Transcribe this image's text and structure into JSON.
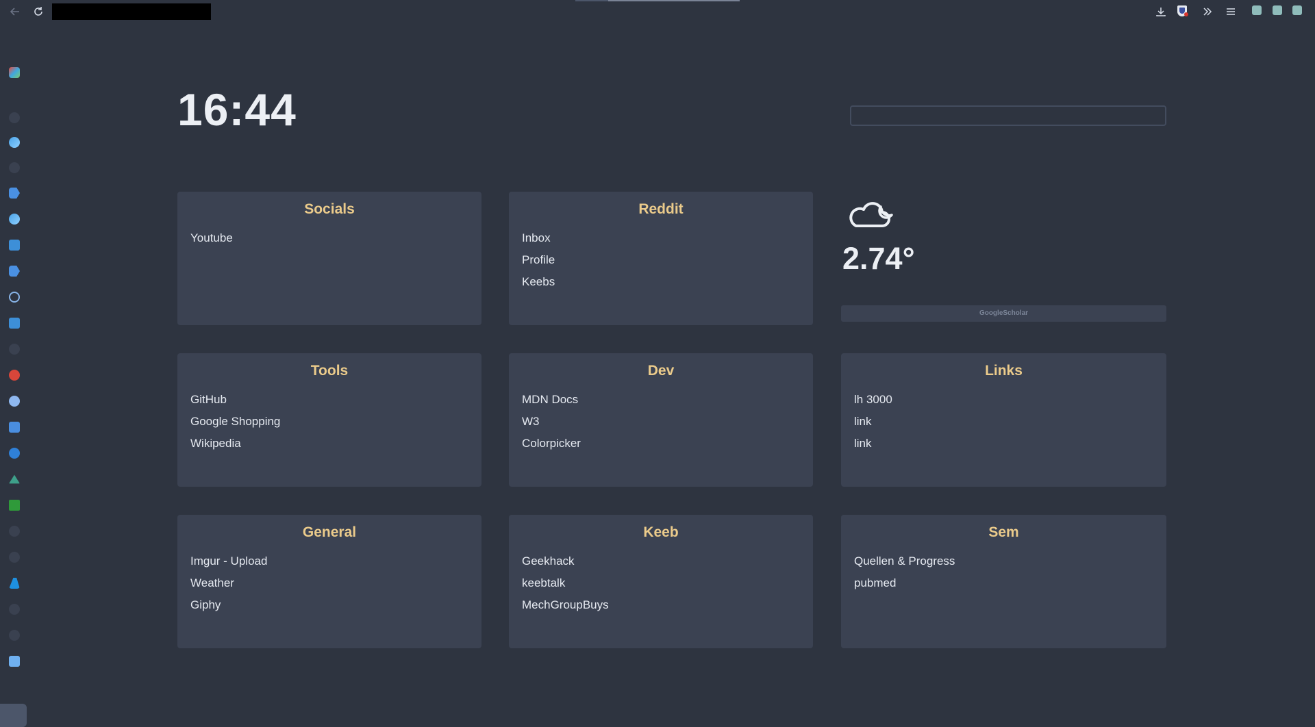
{
  "browser": {
    "back_icon": "arrow-left-icon",
    "reload_icon": "reload-icon",
    "toolbar_icons": [
      "download-icon",
      "shield-extension-icon",
      "overflow-chevrons-icon",
      "menu-icon"
    ]
  },
  "sidebar": {
    "icons": [
      "colorful-app-icon",
      "faded-icon",
      "blue-swirl-icon",
      "faded-icon",
      "blue-tag-icon",
      "blue-swirl-icon",
      "blue-window-icon",
      "blue-tag-icon",
      "info-icon",
      "blue-window-icon",
      "github-icon",
      "red-circle-icon",
      "chart-icon",
      "mt-icon",
      "blue-circle-icon",
      "green-triangle-icon",
      "green-square-icon",
      "github-icon",
      "github-icon",
      "blue-person-icon",
      "github-icon",
      "github-icon",
      "atom-icon"
    ]
  },
  "clock": {
    "time": "16:44"
  },
  "search": {
    "placeholder": "",
    "value": ""
  },
  "weather": {
    "icon": "cloud-moon-icon",
    "temperature": "2.74°"
  },
  "scholar": {
    "label": "GoogleScholar"
  },
  "cards": [
    {
      "title": "Socials",
      "links": [
        "Youtube"
      ]
    },
    {
      "title": "Reddit",
      "links": [
        "Inbox",
        "Profile",
        "Keebs"
      ]
    },
    {
      "title": "Tools",
      "links": [
        "GitHub",
        "Google Shopping",
        "Wikipedia"
      ]
    },
    {
      "title": "Dev",
      "links": [
        "MDN Docs",
        "W3",
        "Colorpicker"
      ]
    },
    {
      "title": "Links",
      "links": [
        "lh 3000",
        "link",
        "link"
      ]
    },
    {
      "title": "General",
      "links": [
        "Imgur - Upload",
        "Weather",
        "Giphy"
      ]
    },
    {
      "title": "Keeb",
      "links": [
        "Geekhack",
        "keebtalk",
        "MechGroupBuys"
      ]
    },
    {
      "title": "Sem",
      "links": [
        "Quellen & Progress",
        "pubmed"
      ]
    }
  ],
  "colors": {
    "background": "#2e3440",
    "card": "#3b4252",
    "heading": "#ebcb8b",
    "text": "#e5e9f0"
  }
}
